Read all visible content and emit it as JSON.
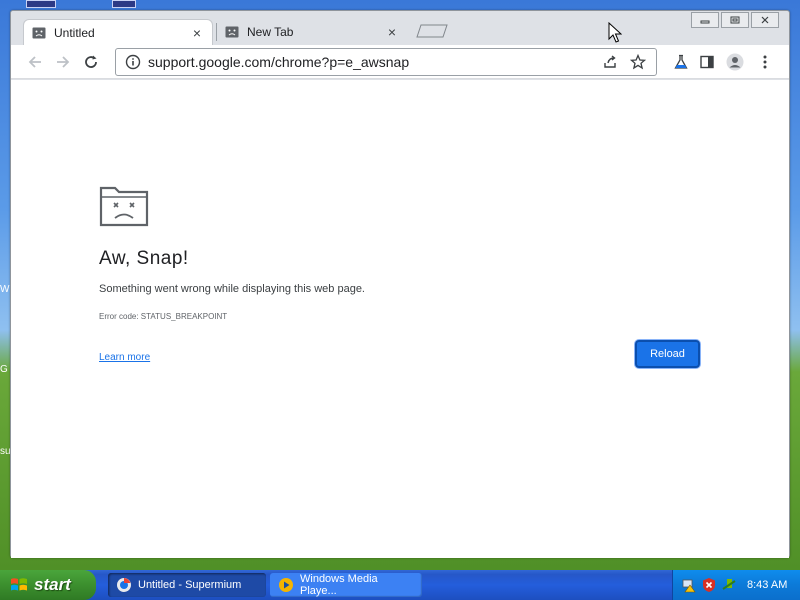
{
  "desktop": {
    "edge_letters": [
      "W",
      "G",
      "su"
    ]
  },
  "browser": {
    "tabs": [
      {
        "title": "Untitled",
        "active": true
      },
      {
        "title": "New Tab",
        "active": false
      }
    ],
    "address": {
      "url": "support.google.com/chrome?p=e_awsnap"
    },
    "error_page": {
      "title": "Aw, Snap!",
      "message": "Something went wrong while displaying this web page.",
      "error_code": "Error code: STATUS_BREAKPOINT",
      "learn_more": "Learn more",
      "reload": "Reload"
    }
  },
  "taskbar": {
    "start_label": "start",
    "tasks": [
      {
        "label": "Untitled - Supermium",
        "active": true,
        "icon": "supermium-icon"
      },
      {
        "label": "Windows Media Playe...",
        "active": false,
        "icon": "media-player-icon"
      }
    ],
    "clock": "8:43 AM",
    "tray_icons": [
      "network-warning-icon",
      "security-alert-icon",
      "safely-remove-icon"
    ]
  },
  "colors": {
    "accent": "#1a73e8",
    "taskbar": "#245edc",
    "start_green": "#3c8f2e"
  }
}
